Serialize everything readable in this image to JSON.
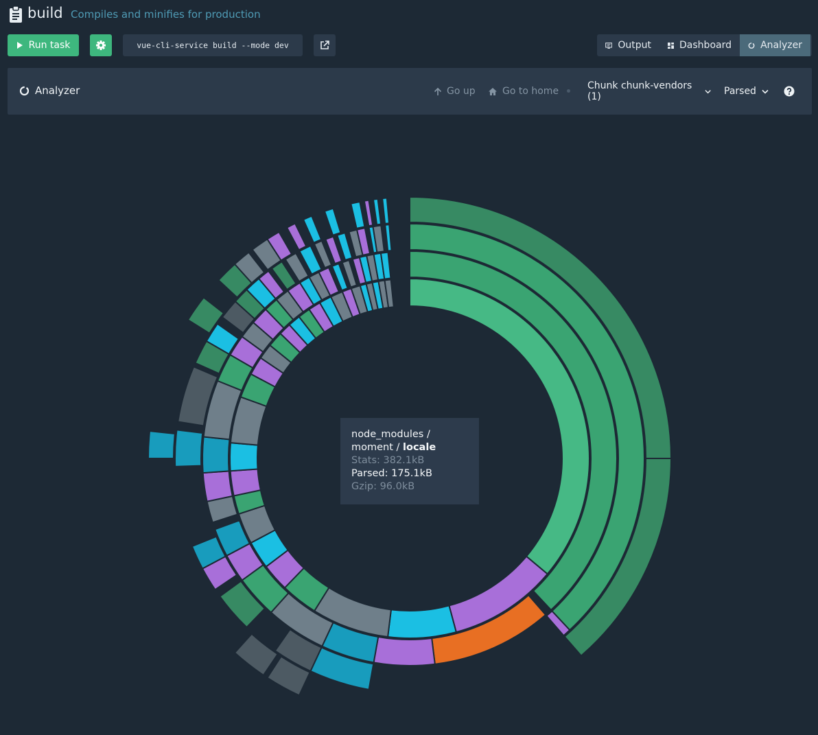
{
  "header": {
    "task_name": "build",
    "task_description": "Compiles and minifies for production"
  },
  "toolbar": {
    "run_label": "Run task",
    "command": "vue-cli-service build --mode dev",
    "tabs": [
      {
        "label": "Output",
        "icon": "terminal-icon"
      },
      {
        "label": "Dashboard",
        "icon": "dashboard-icon"
      },
      {
        "label": "Analyzer",
        "icon": "donut-icon",
        "active": true
      }
    ]
  },
  "analyzer": {
    "title": "Analyzer",
    "go_up": "Go up",
    "go_home": "Go to home",
    "chunk_select": "Chunk chunk-vendors (1)",
    "size_select": "Parsed"
  },
  "tooltip": {
    "path_prefix": "node_modules / moment /",
    "path_current": "locale",
    "stats": "Stats: 382.1kB",
    "parsed": "Parsed: 175.1kB",
    "gzip": "Gzip: 96.0kB"
  },
  "colors": {
    "background": "#1d2935",
    "panel": "#2c3a4a",
    "accent_green": "#3eb77e",
    "active_tab": "#4b6a7a",
    "sunburst": {
      "green_dark": "#378a63",
      "green_mid": "#3aa472",
      "green_light": "#46b985",
      "purple": "#a86fd9",
      "orange": "#e86f23",
      "cyan": "#1bbfe3",
      "teal": "#189cbd",
      "slate": "#6f7f8a",
      "slate_dark": "#4d5a63"
    }
  },
  "chart_data": {
    "type": "sunburst",
    "hovered": "node_modules / moment / locale",
    "levels_shown": 4,
    "segments": [
      {
        "ring": 1,
        "start_deg": 0,
        "end_deg": 130,
        "color": "green_light"
      },
      {
        "ring": 2,
        "start_deg": 0,
        "end_deg": 137,
        "color": "green_mid"
      },
      {
        "ring": 3,
        "start_deg": 0,
        "end_deg": 137,
        "color": "green_mid"
      },
      {
        "ring": 4,
        "start_deg": 0,
        "end_deg": 90,
        "color": "green_dark"
      },
      {
        "ring": 4,
        "start_deg": 90,
        "end_deg": 139,
        "color": "green_dark"
      },
      {
        "ring": 1,
        "start_deg": 130,
        "end_deg": 165,
        "color": "purple"
      },
      {
        "ring": 2,
        "start_deg": 139,
        "end_deg": 173,
        "color": "orange"
      },
      {
        "ring": 2,
        "start_deg": 173,
        "end_deg": 190,
        "color": "purple"
      },
      {
        "ring": 3,
        "start_deg": 137,
        "end_deg": 139,
        "color": "purple"
      },
      {
        "ring": 1,
        "start_deg": 165,
        "end_deg": 187,
        "color": "cyan"
      },
      {
        "ring": 2,
        "start_deg": 190,
        "end_deg": 205,
        "color": "teal"
      },
      {
        "ring": 3,
        "start_deg": 190,
        "end_deg": 205,
        "color": "teal"
      },
      {
        "ring": 1,
        "start_deg": 187,
        "end_deg": 212,
        "color": "slate"
      },
      {
        "ring": 2,
        "start_deg": 205,
        "end_deg": 222,
        "color": "slate"
      },
      {
        "ring": 3,
        "start_deg": 205,
        "end_deg": 215,
        "color": "slate_dark"
      },
      {
        "ring": 4,
        "start_deg": 205,
        "end_deg": 213,
        "color": "slate_dark"
      },
      {
        "ring": 4,
        "start_deg": 214,
        "end_deg": 222,
        "color": "slate_dark"
      },
      {
        "ring": 1,
        "start_deg": 212,
        "end_deg": 224,
        "color": "green_mid"
      },
      {
        "ring": 2,
        "start_deg": 222,
        "end_deg": 234,
        "color": "green_mid"
      },
      {
        "ring": 3,
        "start_deg": 224,
        "end_deg": 234,
        "color": "green_dark"
      },
      {
        "ring": 1,
        "start_deg": 224,
        "end_deg": 233,
        "color": "purple"
      },
      {
        "ring": 2,
        "start_deg": 234,
        "end_deg": 242,
        "color": "purple"
      },
      {
        "ring": 3,
        "start_deg": 236,
        "end_deg": 242,
        "color": "purple"
      },
      {
        "ring": 1,
        "start_deg": 233,
        "end_deg": 242,
        "color": "cyan"
      },
      {
        "ring": 2,
        "start_deg": 242,
        "end_deg": 250,
        "color": "teal"
      },
      {
        "ring": 3,
        "start_deg": 242,
        "end_deg": 248,
        "color": "teal"
      },
      {
        "ring": 1,
        "start_deg": 242,
        "end_deg": 252,
        "color": "slate"
      },
      {
        "ring": 2,
        "start_deg": 252,
        "end_deg": 258,
        "color": "slate"
      },
      {
        "ring": 1,
        "start_deg": 252,
        "end_deg": 258,
        "color": "green_mid"
      },
      {
        "ring": 1,
        "start_deg": 258,
        "end_deg": 266,
        "color": "purple"
      },
      {
        "ring": 2,
        "start_deg": 258,
        "end_deg": 266,
        "color": "purple"
      },
      {
        "ring": 1,
        "start_deg": 266,
        "end_deg": 275,
        "color": "cyan"
      },
      {
        "ring": 2,
        "start_deg": 266,
        "end_deg": 276,
        "color": "teal"
      },
      {
        "ring": 3,
        "start_deg": 268,
        "end_deg": 277,
        "color": "teal"
      },
      {
        "ring": 4,
        "start_deg": 270,
        "end_deg": 276,
        "color": "teal"
      },
      {
        "ring": 1,
        "start_deg": 275,
        "end_deg": 290,
        "color": "slate"
      },
      {
        "ring": 2,
        "start_deg": 276,
        "end_deg": 292,
        "color": "slate"
      },
      {
        "ring": 3,
        "start_deg": 279,
        "end_deg": 293,
        "color": "slate_dark"
      },
      {
        "ring": 1,
        "start_deg": 290,
        "end_deg": 298,
        "color": "green_mid"
      },
      {
        "ring": 2,
        "start_deg": 292,
        "end_deg": 300,
        "color": "green_mid"
      },
      {
        "ring": 3,
        "start_deg": 294,
        "end_deg": 300,
        "color": "green_dark"
      },
      {
        "ring": 1,
        "start_deg": 298,
        "end_deg": 304,
        "color": "purple"
      },
      {
        "ring": 2,
        "start_deg": 300,
        "end_deg": 306,
        "color": "purple"
      },
      {
        "ring": 3,
        "start_deg": 300,
        "end_deg": 305,
        "color": "cyan"
      },
      {
        "ring": 4,
        "start_deg": 302,
        "end_deg": 308,
        "color": "green_dark"
      },
      {
        "ring": 1,
        "start_deg": 304,
        "end_deg": 309,
        "color": "slate"
      },
      {
        "ring": 2,
        "start_deg": 306,
        "end_deg": 311,
        "color": "slate"
      },
      {
        "ring": 3,
        "start_deg": 307,
        "end_deg": 312,
        "color": "slate_dark"
      },
      {
        "ring": 1,
        "start_deg": 309,
        "end_deg": 314,
        "color": "green_mid"
      },
      {
        "ring": 2,
        "start_deg": 311,
        "end_deg": 316,
        "color": "purple"
      },
      {
        "ring": 3,
        "start_deg": 312,
        "end_deg": 316,
        "color": "green_dark"
      },
      {
        "ring": 4,
        "start_deg": 313,
        "end_deg": 318,
        "color": "green_dark"
      },
      {
        "ring": 1,
        "start_deg": 314,
        "end_deg": 318,
        "color": "purple"
      },
      {
        "ring": 2,
        "start_deg": 316,
        "end_deg": 320,
        "color": "green_mid"
      },
      {
        "ring": 3,
        "start_deg": 316,
        "end_deg": 320,
        "color": "cyan"
      },
      {
        "ring": 4,
        "start_deg": 318,
        "end_deg": 322,
        "color": "slate"
      },
      {
        "ring": 1,
        "start_deg": 318,
        "end_deg": 322,
        "color": "cyan"
      },
      {
        "ring": 2,
        "start_deg": 320,
        "end_deg": 324,
        "color": "slate"
      },
      {
        "ring": 3,
        "start_deg": 320,
        "end_deg": 323,
        "color": "purple"
      },
      {
        "ring": 4,
        "start_deg": 323,
        "end_deg": 327,
        "color": "slate"
      },
      {
        "ring": 1,
        "start_deg": 322,
        "end_deg": 326,
        "color": "green_mid"
      },
      {
        "ring": 2,
        "start_deg": 324,
        "end_deg": 328,
        "color": "purple"
      },
      {
        "ring": 3,
        "start_deg": 324,
        "end_deg": 327,
        "color": "green_dark"
      },
      {
        "ring": 4,
        "start_deg": 327,
        "end_deg": 330,
        "color": "purple"
      },
      {
        "ring": 1,
        "start_deg": 326,
        "end_deg": 330,
        "color": "purple"
      },
      {
        "ring": 2,
        "start_deg": 328,
        "end_deg": 331,
        "color": "cyan"
      },
      {
        "ring": 3,
        "start_deg": 328,
        "end_deg": 331,
        "color": "slate"
      },
      {
        "ring": 1,
        "start_deg": 330,
        "end_deg": 334,
        "color": "cyan"
      },
      {
        "ring": 2,
        "start_deg": 331,
        "end_deg": 334,
        "color": "slate"
      },
      {
        "ring": 3,
        "start_deg": 332,
        "end_deg": 335,
        "color": "cyan"
      },
      {
        "ring": 4,
        "start_deg": 332,
        "end_deg": 334,
        "color": "purple"
      },
      {
        "ring": 1,
        "start_deg": 334,
        "end_deg": 338,
        "color": "slate"
      },
      {
        "ring": 2,
        "start_deg": 334,
        "end_deg": 337,
        "color": "purple"
      },
      {
        "ring": 3,
        "start_deg": 336,
        "end_deg": 338,
        "color": "slate"
      },
      {
        "ring": 4,
        "start_deg": 336,
        "end_deg": 338,
        "color": "cyan"
      },
      {
        "ring": 1,
        "start_deg": 338,
        "end_deg": 341,
        "color": "purple"
      },
      {
        "ring": 2,
        "start_deg": 338,
        "end_deg": 340,
        "color": "cyan"
      },
      {
        "ring": 3,
        "start_deg": 339,
        "end_deg": 341,
        "color": "purple"
      },
      {
        "ring": 1,
        "start_deg": 341,
        "end_deg": 344,
        "color": "slate"
      },
      {
        "ring": 2,
        "start_deg": 341,
        "end_deg": 343,
        "color": "slate"
      },
      {
        "ring": 3,
        "start_deg": 342,
        "end_deg": 344,
        "color": "cyan"
      },
      {
        "ring": 4,
        "start_deg": 341,
        "end_deg": 343,
        "color": "cyan"
      },
      {
        "ring": 1,
        "start_deg": 344,
        "end_deg": 346,
        "color": "cyan"
      },
      {
        "ring": 2,
        "start_deg": 344,
        "end_deg": 346,
        "color": "purple"
      },
      {
        "ring": 3,
        "start_deg": 345,
        "end_deg": 347,
        "color": "slate"
      },
      {
        "ring": 1,
        "start_deg": 346,
        "end_deg": 348,
        "color": "slate"
      },
      {
        "ring": 2,
        "start_deg": 346,
        "end_deg": 348,
        "color": "cyan"
      },
      {
        "ring": 3,
        "start_deg": 347,
        "end_deg": 349,
        "color": "purple"
      },
      {
        "ring": 4,
        "start_deg": 347,
        "end_deg": 349,
        "color": "cyan"
      },
      {
        "ring": 1,
        "start_deg": 348,
        "end_deg": 350,
        "color": "cyan"
      },
      {
        "ring": 2,
        "start_deg": 348,
        "end_deg": 350,
        "color": "slate"
      },
      {
        "ring": 3,
        "start_deg": 350,
        "end_deg": 351,
        "color": "cyan"
      },
      {
        "ring": 4,
        "start_deg": 350,
        "end_deg": 351,
        "color": "purple"
      },
      {
        "ring": 1,
        "start_deg": 350,
        "end_deg": 352,
        "color": "slate"
      },
      {
        "ring": 2,
        "start_deg": 350,
        "end_deg": 352,
        "color": "cyan"
      },
      {
        "ring": 3,
        "start_deg": 351,
        "end_deg": 353,
        "color": "slate"
      },
      {
        "ring": 4,
        "start_deg": 352,
        "end_deg": 353,
        "color": "cyan"
      },
      {
        "ring": 1,
        "start_deg": 352,
        "end_deg": 354,
        "color": "slate"
      },
      {
        "ring": 2,
        "start_deg": 352,
        "end_deg": 354,
        "color": "cyan"
      },
      {
        "ring": 3,
        "start_deg": 354,
        "end_deg": 355,
        "color": "cyan"
      },
      {
        "ring": 4,
        "start_deg": 354,
        "end_deg": 355,
        "color": "cyan"
      }
    ]
  }
}
